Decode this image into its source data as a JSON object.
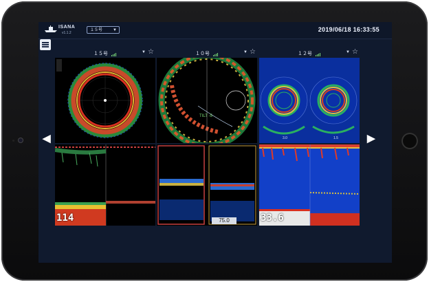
{
  "app": {
    "name": "ISANA",
    "version": "v1.1.2"
  },
  "header": {
    "vessel_select": "１５号",
    "datetime": "2019/06/18 16:33:55"
  },
  "columns": [
    {
      "title": "１５号"
    },
    {
      "title": "１０号"
    },
    {
      "title": "１２号"
    }
  ],
  "panels": {
    "sonar2": {
      "label": "TILT -5"
    },
    "sonar3": {
      "left_range": "3.0",
      "right_range": "1.5"
    },
    "echo1": {
      "depth": "114"
    },
    "echo2": {
      "depth": "75.0"
    },
    "echo3": {
      "depth": "33.6"
    }
  },
  "icons": [
    "hamburger-menu-icon",
    "signal-bars-icon",
    "star-icon",
    "chevron-left-icon",
    "chevron-right-icon",
    "dropdown-arrow-icon"
  ],
  "colors": {
    "screen_bg": "#101a2e",
    "accent_text": "#eef3ff",
    "sonar_blue_bg": "#0a2f9e"
  }
}
